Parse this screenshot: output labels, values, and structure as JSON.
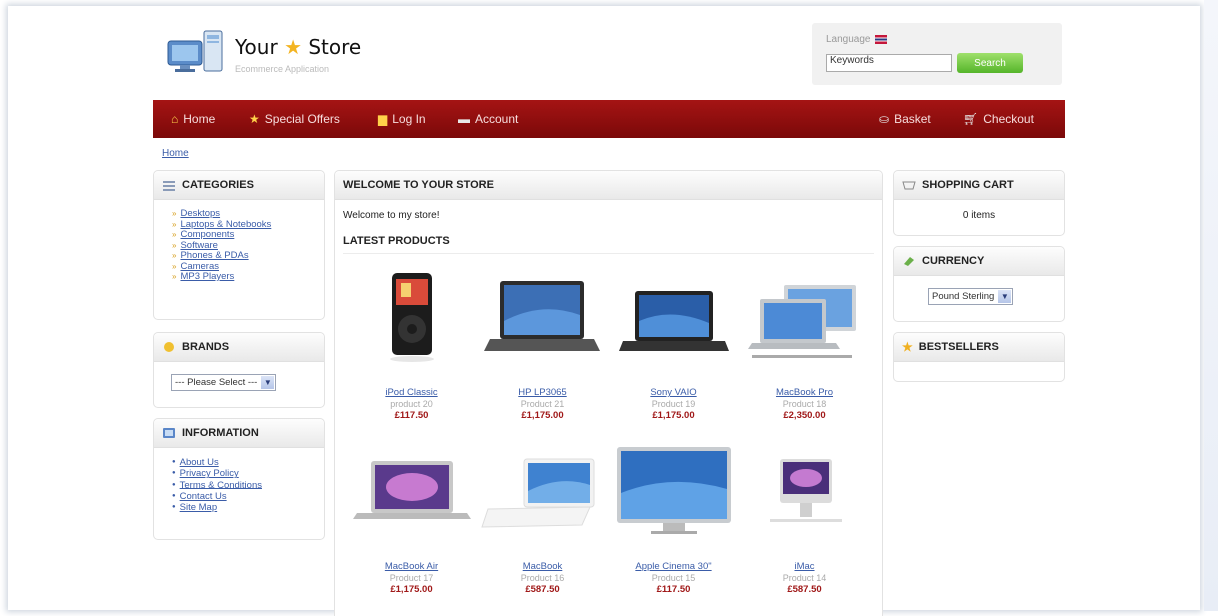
{
  "header": {
    "store_title": "Your",
    "store_title_2": "Store",
    "subtitle": "Ecommerce Application",
    "language_label": "Language",
    "search_placeholder": "Keywords",
    "search_button": "Search"
  },
  "nav": {
    "home": "Home",
    "special_offers": "Special Offers",
    "login": "Log In",
    "account": "Account",
    "basket": "Basket",
    "checkout": "Checkout"
  },
  "breadcrumb": "Home",
  "categories": {
    "title": "CATEGORIES",
    "items": [
      "Desktops",
      "Laptops & Notebooks",
      "Components",
      "Software",
      "Phones & PDAs",
      "Cameras",
      "MP3 Players"
    ]
  },
  "brands": {
    "title": "BRANDS",
    "selected": "--- Please Select ---"
  },
  "information": {
    "title": "INFORMATION",
    "items": [
      "About Us",
      "Privacy Policy",
      "Terms & Conditions",
      "Contact Us",
      "Site Map"
    ]
  },
  "welcome": {
    "title": "WELCOME TO YOUR STORE",
    "text": "Welcome to my store!",
    "latest_title": "LATEST PRODUCTS"
  },
  "products": [
    {
      "name": "iPod Classic",
      "model": "product 20",
      "price": "£117.50"
    },
    {
      "name": "HP LP3065",
      "model": "Product 21",
      "price": "£1,175.00"
    },
    {
      "name": "Sony VAIO",
      "model": "Product 19",
      "price": "£1,175.00"
    },
    {
      "name": "MacBook Pro",
      "model": "Product 18",
      "price": "£2,350.00"
    },
    {
      "name": "MacBook Air",
      "model": "Product 17",
      "price": "£1,175.00"
    },
    {
      "name": "MacBook",
      "model": "Product 16",
      "price": "£587.50"
    },
    {
      "name": "Apple Cinema 30\"",
      "model": "Product 15",
      "price": "£117.50"
    },
    {
      "name": "iMac",
      "model": "Product 14",
      "price": "£587.50"
    }
  ],
  "cart": {
    "title": "SHOPPING CART",
    "text": "0 items"
  },
  "currency": {
    "title": "CURRENCY",
    "selected": "Pound Sterling"
  },
  "bestsellers": {
    "title": "BESTSELLERS"
  },
  "colors": {
    "nav_bg": "#8e0e0e",
    "link": "#3a5ca8",
    "price": "#a01818",
    "search_button": "#55b52a"
  }
}
